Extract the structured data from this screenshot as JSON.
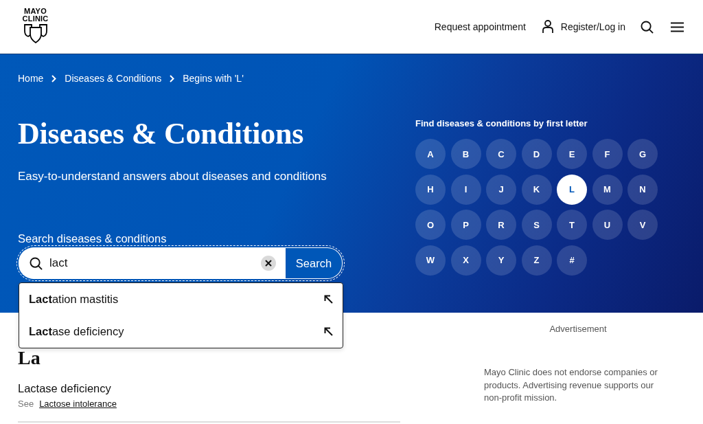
{
  "header": {
    "logo": {
      "lines": [
        "MAYO",
        "CLINIC"
      ]
    },
    "nav": [
      {
        "kind": "link",
        "label": "Request appointment"
      },
      {
        "kind": "account",
        "label": "Register/Log in"
      },
      {
        "kind": "search"
      },
      {
        "kind": "menu"
      }
    ]
  },
  "hero": {
    "breadcrumb": [
      "Home",
      "Diseases & Conditions",
      "Begins with 'L'"
    ],
    "title": "Diseases & Conditions",
    "subtitle": "Easy-to-understand answers about diseases and conditions",
    "search": {
      "label": "Search diseases & conditions",
      "value": "lact",
      "button": "Search",
      "suggestions": [
        {
          "text": "**Lact**ation mastitis"
        },
        {
          "text": "**Lact**ase deficiency"
        }
      ]
    },
    "letter_nav": {
      "heading": "Find diseases & conditions by first letter",
      "letters": [
        {
          "label": "A",
          "selected": false
        },
        {
          "label": "B",
          "selected": false
        },
        {
          "label": "C",
          "selected": false
        },
        {
          "label": "D",
          "selected": false
        },
        {
          "label": "E",
          "selected": false
        },
        {
          "label": "F",
          "selected": false
        },
        {
          "label": "G",
          "selected": false
        },
        {
          "label": "H",
          "selected": false
        },
        {
          "label": "I",
          "selected": false
        },
        {
          "label": "J",
          "selected": false
        },
        {
          "label": "K",
          "selected": false
        },
        {
          "label": "L",
          "selected": true
        },
        {
          "label": "M",
          "selected": false
        },
        {
          "label": "N",
          "selected": false
        },
        {
          "label": "O",
          "selected": false
        },
        {
          "label": "P",
          "selected": false
        },
        {
          "label": "R",
          "selected": false
        },
        {
          "label": "S",
          "selected": false
        },
        {
          "label": "T",
          "selected": false
        },
        {
          "label": "U",
          "selected": false
        },
        {
          "label": "V",
          "selected": false
        },
        {
          "label": "W",
          "selected": false
        },
        {
          "label": "X",
          "selected": false
        },
        {
          "label": "Y",
          "selected": false
        },
        {
          "label": "Z",
          "selected": false
        },
        {
          "label": "#",
          "selected": false
        }
      ]
    }
  },
  "content": {
    "section_heading": "La",
    "entries": [
      {
        "title": "Lactase deficiency",
        "see_label": "See",
        "see_link": "Lactose intolerance"
      }
    ]
  },
  "aside": {
    "ad_label": "Advertisement",
    "disclaimer": "Mayo Clinic does not endorse companies or products. Advertising revenue supports our non-profit mission."
  }
}
